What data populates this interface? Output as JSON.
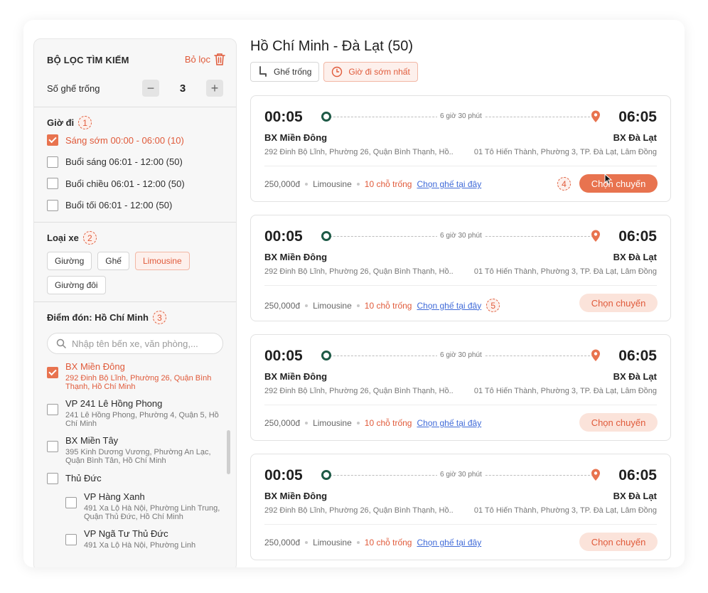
{
  "sidebar": {
    "filter_title": "BỘ LỌC TÌM KIẾM",
    "clear_label": "Bỏ lọc",
    "seats_label": "Số ghế trống",
    "seats_value": "3",
    "minus": "−",
    "plus": "+",
    "time_section": {
      "title": "Giờ đi",
      "badge": "1",
      "options": [
        {
          "label": "Sáng sớm 00:00 - 06:00 (10)",
          "checked": true
        },
        {
          "label": "Buổi sáng 06:01 - 12:00 (50)",
          "checked": false
        },
        {
          "label": "Buổi chiều 06:01 - 12:00 (50)",
          "checked": false
        },
        {
          "label": "Buổi tối 06:01 - 12:00 (50)",
          "checked": false
        }
      ]
    },
    "type_section": {
      "title": "Loại xe",
      "badge": "2",
      "chips": [
        {
          "label": "Giường",
          "selected": false
        },
        {
          "label": "Ghế",
          "selected": false
        },
        {
          "label": "Limousine",
          "selected": true
        },
        {
          "label": "Giường đôi",
          "selected": false
        }
      ]
    },
    "pickup_section": {
      "title": "Điểm đón: Hồ Chí Minh",
      "badge": "3",
      "search_placeholder": "Nhập tên bến xe, văn phòng,...",
      "stops": [
        {
          "name": "BX Miền Đông",
          "addr": "292 Đinh Bộ Lĩnh, Phường 26, Quận Bình Thạnh, Hồ Chí Minh",
          "checked": true
        },
        {
          "name": "VP 241 Lê Hồng Phong",
          "addr": "241 Lê Hồng Phong, Phường 4, Quận 5, Hồ Chí Minh",
          "checked": false
        },
        {
          "name": "BX Miền Tây",
          "addr": "395 Kinh Dương Vương, Phường An Lạc, Quận Bình Tân, Hồ Chí Minh",
          "checked": false
        },
        {
          "name": "Thủ Đức",
          "addr": "",
          "checked": false
        },
        {
          "name": "VP Hàng Xanh",
          "addr": "491 Xa Lộ Hà Nội, Phường Linh Trung, Quận Thủ Đức, Hồ Chí Minh",
          "checked": false
        },
        {
          "name": "VP Ngã Tư Thủ Đức",
          "addr": "491 Xa Lộ Hà Nội, Phường Linh",
          "checked": false
        }
      ]
    }
  },
  "main": {
    "title": "Hồ Chí Minh - Đà Lạt (50)",
    "sort": [
      {
        "label": "Ghế trống",
        "icon": "seat-icon",
        "active": false
      },
      {
        "label": "Giờ đi sớm nhất",
        "icon": "clock-icon",
        "active": true
      }
    ],
    "trips": [
      {
        "dep": "00:05",
        "arr": "06:05",
        "duration": "6 giờ 30 phút",
        "from": "BX Miền Đông",
        "to": "BX Đà Lạt",
        "from_addr": "292 Đinh Bộ Lĩnh, Phường 26, Quận Bình Thạnh, Hồ..",
        "to_addr": "01 Tô Hiến Thành, Phường 3, TP. Đà Lạt, Lâm Đồng",
        "price": "250,000đ",
        "type": "Limousine",
        "free": "10 chỗ trống",
        "seat_link": "Chọn ghế tại đây",
        "button": "Chọn chuyến",
        "button_primary": true
      },
      {
        "dep": "00:05",
        "arr": "06:05",
        "duration": "6 giờ 30 phút",
        "from": "BX Miền Đông",
        "to": "BX Đà Lạt",
        "from_addr": "292 Đinh Bộ Lĩnh, Phường 26, Quận Bình Thạnh, Hồ..",
        "to_addr": "01 Tô Hiến Thành, Phường 3, TP. Đà Lạt, Lâm Đồng",
        "price": "250,000đ",
        "type": "Limousine",
        "free": "10 chỗ trống",
        "seat_link": "Chọn ghế tại đây",
        "button": "Chọn chuyến",
        "button_primary": false
      },
      {
        "dep": "00:05",
        "arr": "06:05",
        "duration": "6 giờ 30 phút",
        "from": "BX Miền Đông",
        "to": "BX Đà Lạt",
        "from_addr": "292 Đinh Bộ Lĩnh, Phường 26, Quận Bình Thạnh, Hồ..",
        "to_addr": "01 Tô Hiến Thành, Phường 3, TP. Đà Lạt, Lâm Đồng",
        "price": "250,000đ",
        "type": "Limousine",
        "free": "10 chỗ trống",
        "seat_link": "Chọn ghế tại đây",
        "button": "Chọn chuyến",
        "button_primary": false
      },
      {
        "dep": "00:05",
        "arr": "06:05",
        "duration": "6 giờ 30 phút",
        "from": "BX Miền Đông",
        "to": "BX Đà Lạt",
        "from_addr": "292 Đinh Bộ Lĩnh, Phường 26, Quận Bình Thạnh, Hồ..",
        "to_addr": "01 Tô Hiến Thành, Phường 3, TP. Đà Lạt, Lâm Đồng",
        "price": "250,000đ",
        "type": "Limousine",
        "free": "10 chỗ trống",
        "seat_link": "Chọn ghế tại đây",
        "button": "Chọn chuyến",
        "button_primary": false
      }
    ],
    "badges": {
      "choose_button": "4",
      "seat_link": "5"
    }
  },
  "colors": {
    "accent": "#e8734f",
    "accent_text": "#e05a3a",
    "start_dot": "#1e5a46",
    "link": "#3f6ad8"
  }
}
